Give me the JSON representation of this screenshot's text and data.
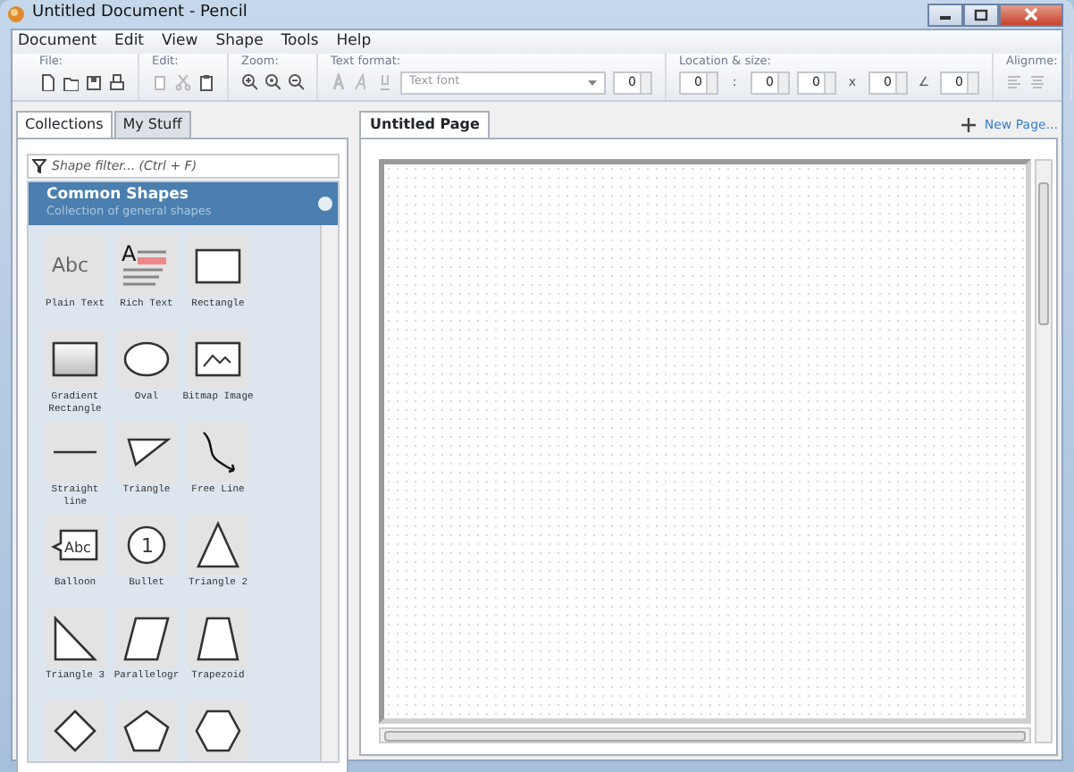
{
  "window": {
    "title": "Untitled Document - Pencil"
  },
  "menu": [
    "Document",
    "Edit",
    "View",
    "Shape",
    "Tools",
    "Help"
  ],
  "toolbar": {
    "groups": [
      {
        "label": "File:",
        "icons": [
          {
            "kind": "new"
          },
          {
            "kind": "open"
          },
          {
            "kind": "save"
          },
          {
            "kind": "print"
          }
        ]
      },
      {
        "label": "Edit:",
        "icons": [
          {
            "kind": "copy"
          },
          {
            "kind": "cut"
          },
          {
            "kind": "paste"
          }
        ]
      },
      {
        "label": "Zoom:",
        "icons": [
          {
            "kind": "zoom-in"
          },
          {
            "kind": "zoom-reset"
          },
          {
            "kind": "zoom-out"
          }
        ]
      },
      {
        "label": "Text format:",
        "icons": [
          {
            "kind": "bold"
          },
          {
            "kind": "italic"
          },
          {
            "kind": "underline"
          }
        ],
        "font": {
          "placeholder": "Text font"
        },
        "size": "0"
      },
      {
        "label": "Location & size:",
        "spinners": [
          {
            "value": "0",
            "sep": ":"
          },
          {
            "value": "0"
          },
          {
            "value": "0",
            "sep": "x"
          },
          {
            "value": "0",
            "sep": "∠"
          },
          {
            "value": "0"
          }
        ]
      },
      {
        "label": "Alignme:",
        "icons": [
          {
            "kind": "align-left"
          },
          {
            "kind": "align-center"
          }
        ]
      }
    ]
  },
  "left_tabs": [
    {
      "label": "Collections",
      "selected": true
    },
    {
      "label": "My Stuff",
      "selected": false
    }
  ],
  "filter": {
    "placeholder": "Shape filter... (Ctrl + F)"
  },
  "collection": {
    "title": "Common Shapes",
    "subtitle": "Collection of general shapes"
  },
  "shapes": [
    {
      "kind": "text",
      "label": "Plain Text",
      "preview": "Abc"
    },
    {
      "kind": "richtext",
      "label": "Rich Text",
      "preview": "A"
    },
    {
      "kind": "rect",
      "label": "Rectangle"
    },
    {
      "kind": "gradient",
      "label": "Gradient Rectangle"
    },
    {
      "kind": "oval",
      "label": "Oval"
    },
    {
      "kind": "bitmap",
      "label": "Bitmap Image"
    },
    {
      "kind": "line",
      "label": "Straight line"
    },
    {
      "kind": "triangle",
      "label": "Triangle"
    },
    {
      "kind": "freeline",
      "label": "Free Line"
    },
    {
      "kind": "balloon",
      "label": "Balloon",
      "preview": "Abc"
    },
    {
      "kind": "bullet",
      "label": "Bullet",
      "preview": "1"
    },
    {
      "kind": "triangle2",
      "label": "Triangle 2"
    },
    {
      "kind": "triangle3",
      "label": "Triangle 3"
    },
    {
      "kind": "parallelogram",
      "label": "Parallelogr"
    },
    {
      "kind": "trapezoid",
      "label": "Trapezoid"
    },
    {
      "kind": "diamond"
    },
    {
      "kind": "pentagon"
    },
    {
      "kind": "hexagon"
    }
  ],
  "pages": [
    {
      "label": "Untitled Page",
      "selected": true
    }
  ],
  "new_page": "New Page..."
}
